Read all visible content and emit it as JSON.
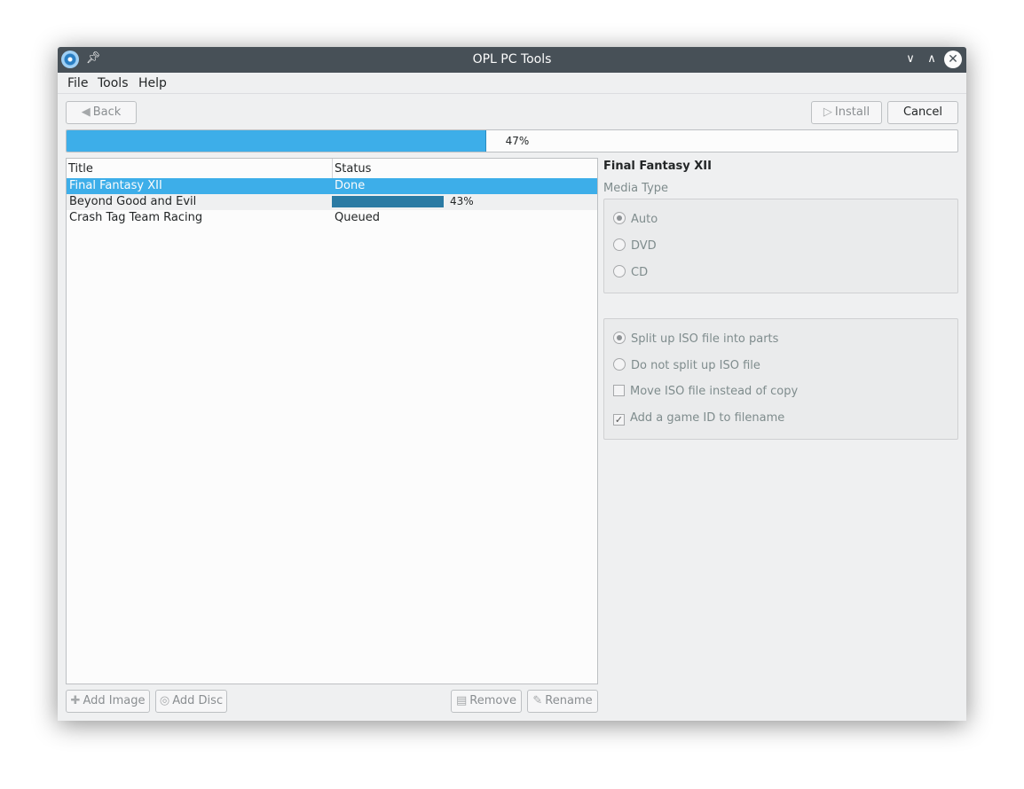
{
  "window": {
    "title": "OPL PC Tools"
  },
  "menu": {
    "file": "File",
    "tools": "Tools",
    "help": "Help"
  },
  "toolbar": {
    "back": "Back",
    "install": "Install",
    "cancel": "Cancel"
  },
  "progress": {
    "value": 47,
    "label": "47%"
  },
  "list": {
    "headers": {
      "title": "Title",
      "status": "Status"
    },
    "rows": [
      {
        "title": "Final Fantasy XII",
        "status": "Done"
      },
      {
        "title": "Beyond Good and Evil",
        "status": "",
        "progress": 43,
        "progress_label": "43%"
      },
      {
        "title": "Crash Tag Team Racing",
        "status": "Queued"
      }
    ]
  },
  "details": {
    "title": "Final Fantasy XII",
    "media_type_label": "Media Type",
    "media_options": [
      "Auto",
      "DVD",
      "CD"
    ],
    "media_selected": "Auto",
    "split_options": [
      "Split up ISO file into parts",
      "Do not split up ISO file"
    ],
    "split_selected": "Split up ISO file into parts",
    "move_iso": {
      "label": "Move ISO file instead of copy",
      "checked": false
    },
    "add_game_id": {
      "label": "Add a game ID to filename",
      "checked": true
    }
  },
  "bottom_buttons": {
    "add_image": "Add Image",
    "add_disc": "Add Disc",
    "remove": "Remove",
    "rename": "Rename"
  },
  "colors": {
    "accent": "#3daee9",
    "titlebar": "#475057",
    "row_progress": "#2a7aa3"
  }
}
